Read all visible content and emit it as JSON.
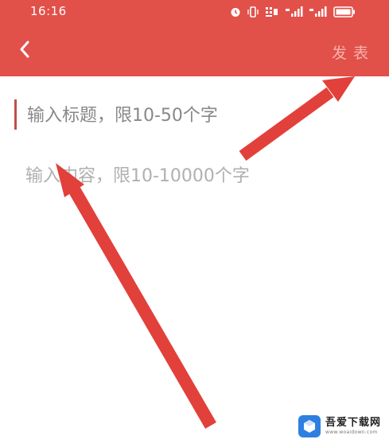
{
  "status_bar": {
    "time": "16:16",
    "icons": [
      "alarm-icon",
      "vibrate-icon",
      "data-speed-icon",
      "signal-icon",
      "signal-icon",
      "battery-icon"
    ]
  },
  "nav": {
    "back_icon": "chevron-left-icon",
    "publish_label": "发表"
  },
  "editor": {
    "title_placeholder": "输入标题，限10-50个字",
    "content_placeholder": "输入内容，限10-10000个字"
  },
  "watermark": {
    "name": "吾爱下载网",
    "url": "www.woaidown.com"
  },
  "colors": {
    "header_bg": "#e2504a",
    "publish_text": "#f6b3ad",
    "arrow": "#e2403a",
    "cursor": "#c0504a"
  }
}
